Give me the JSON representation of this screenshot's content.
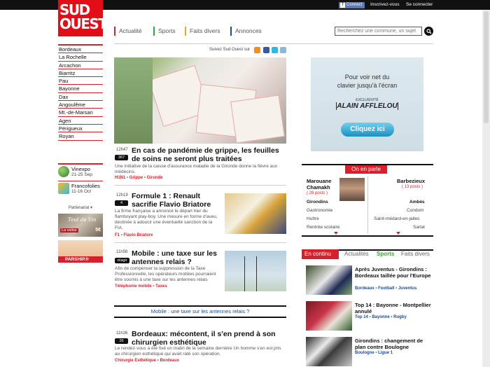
{
  "topbar": {
    "connect": "Connect",
    "register": "Inscrivez-vous",
    "login": "Se connecter"
  },
  "logo": {
    "line1": "SUD",
    "line2": "OUEST"
  },
  "nav": [
    "Actualité",
    "Sports",
    "Faits divers",
    "Annonces"
  ],
  "search": {
    "placeholder": "Recherchez une commune, un sujet"
  },
  "cities": [
    "Bordeaux",
    "La Rochelle",
    "Arcachon",
    "Biarritz",
    "Pau",
    "Bayonne",
    "Dax",
    "Angoulême",
    "Mt.-de-Marsan",
    "Agen",
    "Périgueux",
    "Royan"
  ],
  "events": [
    {
      "name": "Vinexpo",
      "date": "21-25 Sep"
    },
    {
      "name": "Francofolies",
      "date": "11-16 Oct"
    }
  ],
  "partners": {
    "title": "Partenariat",
    "toutdevin": {
      "brand": "Tout de Vin",
      "tag": "La valise",
      "price": "5€"
    },
    "parship": "PARSHIP.fr"
  },
  "follow": "Suivez Sud Ouest sur",
  "articles": [
    {
      "time": "12h47",
      "count": "367",
      "title": "En cas de pandémie de grippe, les feuilles de soins ne seront plus traitées",
      "summary": "Une initiative de la caisse d'assurance maladie de la Gironde donne la fièvre aux médecins.",
      "tags": [
        "H1N1",
        "Grippe",
        "Gironde"
      ]
    },
    {
      "time": "12h19",
      "count": "4",
      "title": "Formule 1 : Renault sacrifie Flavio Briatore",
      "summary": "La firme française a annoncé le départ hier du flamboyant play-boy. Une mesure en forme d'aveu, destinée à adoucir une éventuelle sanction de la FIA.",
      "tags": [
        "F1",
        "Flavio Briatore"
      ]
    },
    {
      "time": "11h58",
      "count": "réagir",
      "title": "Mobile : une taxe sur les antennes relais ?",
      "summary": "Afin de compenser la suppression de la Taxe Professionnelle, les opérateurs mobiles pourraient être soumis à une taxe sur les antennes relais",
      "tags": [
        "Téléphonie mobile",
        "Taxes"
      ]
    },
    {
      "time": "11h26",
      "count": "26",
      "title": "Bordeaux: mécontent, il s'en prend à son chirurgien esthétique",
      "summary": "Le rendez-vous a été fixé un matin de la semaine dernière Un homme s'en est pris au chirurgien esthétique qui avait raté son opération.",
      "tags": [
        "Chirurgie Esthétique",
        "Bordeaux"
      ]
    }
  ],
  "poll": "Mobile : une taxe sur les antennes relais ?",
  "ad": {
    "line1": "Pour voir net du",
    "line2": "clavier jusqu'à l'écran",
    "exclu": "EXCLUSIVITÉ",
    "brand": "ALAIN AFFLELOU",
    "cta": "Cliquez ici"
  },
  "onenparle": {
    "label": "On en parle",
    "left": {
      "name1": "Marouane",
      "name2": "Chamakh",
      "posts": "( 28 posts )",
      "items": [
        "Girondins",
        "Gastronomie",
        "Huître",
        "Rentrée scolaire"
      ]
    },
    "right": {
      "name": "Barbezieux",
      "posts": "( 13 posts )",
      "items": [
        "Ambès",
        "Condom",
        "Saint-médard-en-jalles",
        "Sarlat"
      ]
    }
  },
  "encontinu": {
    "tabs": [
      "En continu",
      "Actualités",
      "Sports",
      "Faits divers"
    ],
    "items": [
      {
        "title": "Après Juventus - Girondins : Bordeaux taillée pour l'Europe",
        "tags": [
          "Bordeaux",
          "Football",
          "Juventus"
        ]
      },
      {
        "title": "Top 14 : Bayonne - Montpellier annulé",
        "tags": [
          "Top 14",
          "Bayonne",
          "Rugby"
        ]
      },
      {
        "title": "Girondins : changement de plan contre Boulogne",
        "tags": [
          "Boulogne",
          "Ligue 1"
        ]
      }
    ]
  }
}
